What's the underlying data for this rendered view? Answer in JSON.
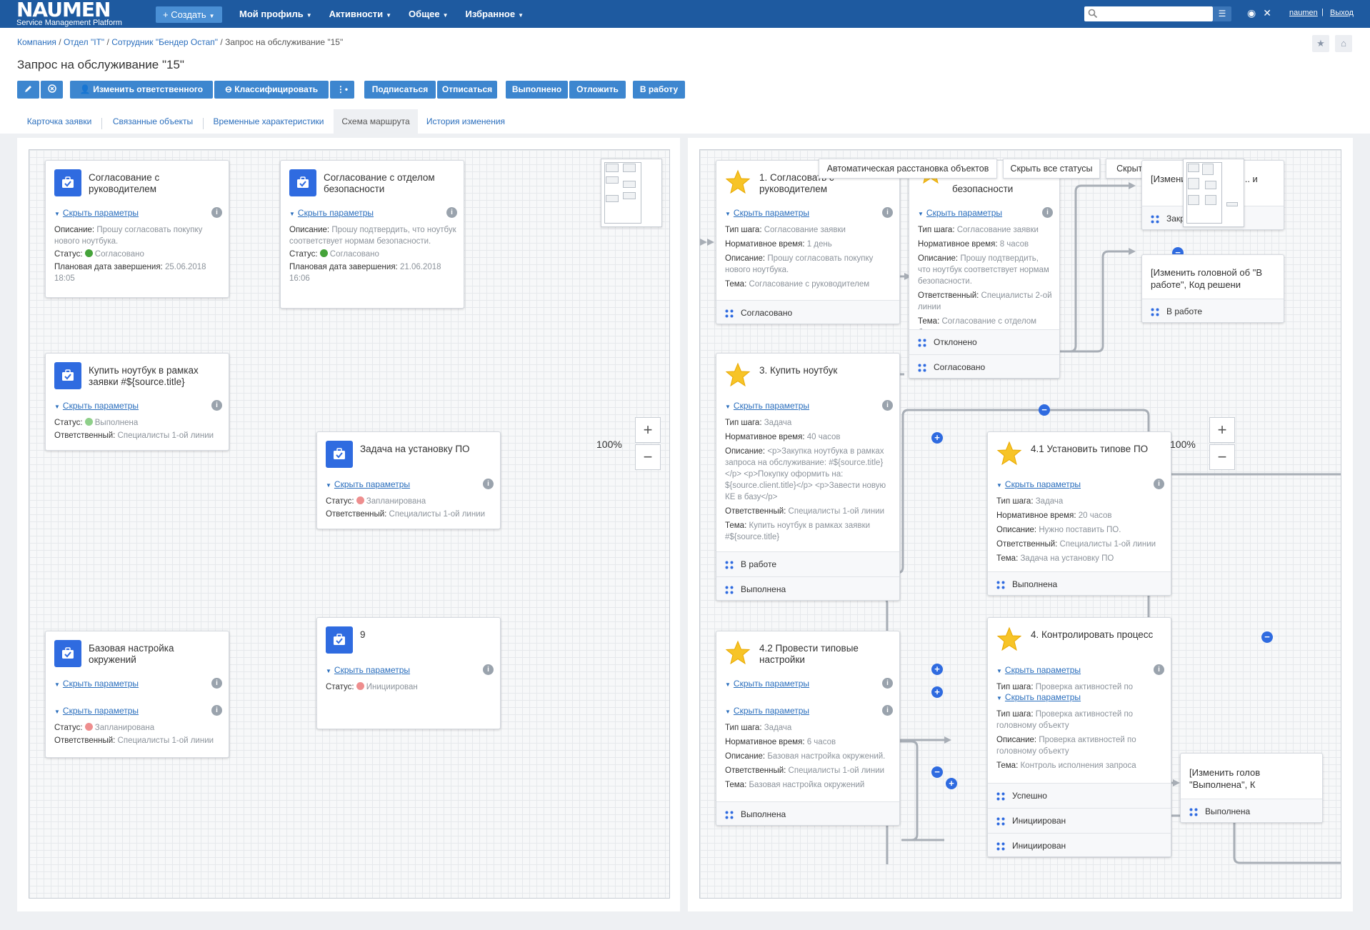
{
  "app": {
    "logo": "NAUMEN",
    "logo_sub": "Service Management Platform",
    "create_label": "+ Создать",
    "nav": [
      "Мой профиль",
      "Активности",
      "Общее",
      "Избранное"
    ],
    "user": "naumen",
    "sep": "|",
    "logout": "Выход",
    "search_placeholder": ""
  },
  "breadcrumb": {
    "items": [
      "Компания",
      "Отдел \"IT\"",
      "Сотрудник \"Бендер Остап\""
    ],
    "current": "Запрос на обслуживание \"15\"",
    "sep": " / "
  },
  "page_title": "Запрос на обслуживание \"15\"",
  "toolbar": {
    "change_responsible": "Изменить ответственного",
    "classify": "Классифицировать",
    "subscribe": "Подписаться",
    "unsubscribe": "Отписаться",
    "done": "Выполнено",
    "postpone": "Отложить",
    "to_work": "В работу"
  },
  "tabs": [
    "Карточка заявки",
    "Связанные объекты",
    "Временные характеристики",
    "Схема маршрута",
    "История изменения"
  ],
  "labels": {
    "hide_params": "Скрыть параметры",
    "desc": "Описание:",
    "status": "Статус:",
    "planned_end": "Плановая дата завершения:",
    "responsible": "Ответственный:",
    "step_type": "Тип шага:",
    "norm_time": "Нормативное время:",
    "subject": "Тема:"
  },
  "left_nodes": [
    {
      "title": "Согласование с руководителем",
      "desc": "Прошу согласовать покупку нового ноутбука.",
      "status": "Согласовано",
      "planned": "25.06.2018 18:05"
    },
    {
      "title": "Согласование с отделом безопасности",
      "desc": "Прошу подтвердить, что ноутбук соответствует нормам безопасности.",
      "status": "Согласовано",
      "planned": "21.06.2018 16:06"
    },
    {
      "title": "Купить ноутбук в рамках заявки #${source.title}",
      "status": "Выполнена",
      "responsible": "Специалисты 1-ой линии"
    },
    {
      "title": "Задача на установку ПО",
      "status": "Запланирована",
      "responsible": "Специалисты 1-ой линии"
    },
    {
      "title": "Базовая настройка окружений",
      "status": "Запланирована",
      "responsible": "Специалисты 1-ой линии"
    },
    {
      "title": "9",
      "status": "Инициирован"
    }
  ],
  "zoom": {
    "left": "100%",
    "right": "100%"
  },
  "right_buttons": {
    "auto_layout": "Автоматическая расстановка объектов",
    "hide_statuses": "Скрыть все статусы",
    "hide_params": "Скрыть все параметры"
  },
  "right_nodes": {
    "n1": {
      "title": "1. Согласовать с руководителем",
      "type": "Согласование заявки",
      "norm": "1 день",
      "desc": "Прошу согласовать покупку нового ноутбука.",
      "subject": "Согласование с руководителем",
      "statuses": [
        "Согласовано"
      ]
    },
    "n2": {
      "title": "безопасности",
      "type": "Согласование заявки",
      "norm": "8 часов",
      "desc": "Прошу подтвердить, что ноутбук соответствует нормам безопасности.",
      "responsible": "Специалисты 2-ой линии",
      "subject": "Согласование с отделом безопасности",
      "statuses": [
        "Отклонено",
        "Согласовано"
      ]
    },
    "n3": {
      "title": "3. Купить ноутбук",
      "type": "Задача",
      "norm": "40 часов",
      "desc": "<p>Закупка ноутбука в рамках запроса на обслуживание: #${source.title}</p> <p>Покупку оформить на: ${source.client.title}</p> <p>Завести новую КЕ в базу</p>",
      "responsible": "Специалисты 1-ой линии",
      "subject": "Купить ноутбук в рамках заявки #${source.title}",
      "statuses": [
        "В работе",
        "Выполнена"
      ]
    },
    "n41": {
      "title": "4.1 Установить типове ПО",
      "type": "Задача",
      "norm": "20 часов",
      "desc": "Нужно поставить ПО.",
      "responsible": "Специалисты 1-ой линии",
      "subject": "Задача на установку ПО",
      "statuses": [
        "Выполнена"
      ]
    },
    "n42": {
      "title": "4.2 Провести типовые настройки",
      "type": "Задача",
      "norm": "6 часов",
      "desc": "Базовая настройка окружений.",
      "responsible": "Специалисты 1-ой линии",
      "subject": "Базовая настройка окружений",
      "statuses": [
        "Выполнена"
      ]
    },
    "n4": {
      "title": "4. Контролировать процесс",
      "type_top": "Проверка активностей по",
      "type": "Проверка активностей по головному объекту",
      "desc": "Проверка активностей по головному объекту",
      "subject": "Контроль исполнения запроса",
      "statuses": [
        "Успешно",
        "Инициирован",
        "Инициирован"
      ]
    },
    "e1": {
      "title": "[Изменит... \"Закрыта\"... и",
      "status": "Закры"
    },
    "e2": {
      "title": "[Изменить головной об \"В работе\", Код решени",
      "status": "В работе"
    },
    "e3": {
      "title": "[Изменить голов \"Выполнена\", К",
      "status": "Выполнена"
    }
  }
}
